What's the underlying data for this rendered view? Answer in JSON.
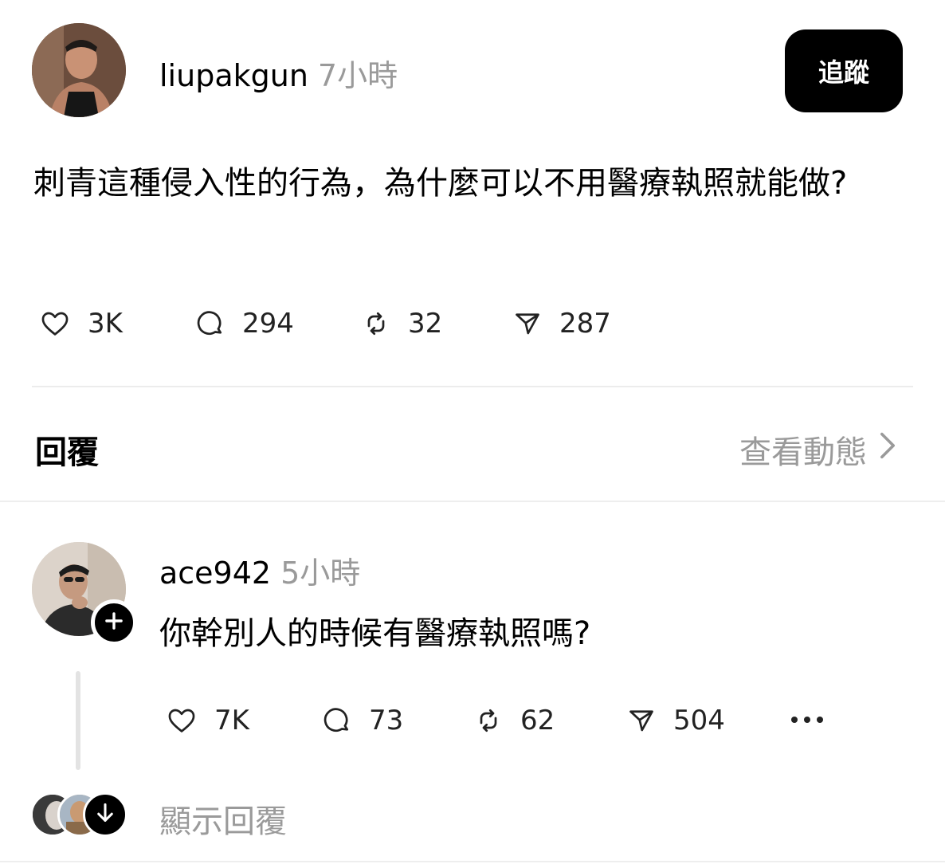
{
  "post": {
    "username": "liupakgun",
    "time": "7小時",
    "follow_label": "追蹤",
    "text": "刺青這種侵入性的行為，為什麼可以不用醫療執照就能做?",
    "stats": {
      "likes": "3K",
      "comments": "294",
      "reposts": "32",
      "shares": "287"
    }
  },
  "replies_section": {
    "title": "回覆",
    "view_activity": "查看動態"
  },
  "reply": {
    "username": "ace942",
    "time": "5小時",
    "text": "你幹別人的時候有醫療執照嗎?",
    "stats": {
      "likes": "7K",
      "comments": "73",
      "reposts": "62",
      "shares": "504"
    },
    "show_replies": "顯示回覆"
  },
  "icons": {
    "like": "heart-icon",
    "comment": "comment-bubble-icon",
    "repost": "repost-icon",
    "share": "send-icon",
    "more": "more-dots-icon",
    "follow_plus": "plus-icon",
    "view_activity": "chevron-right-icon",
    "show_replies": "arrow-down-icon"
  }
}
